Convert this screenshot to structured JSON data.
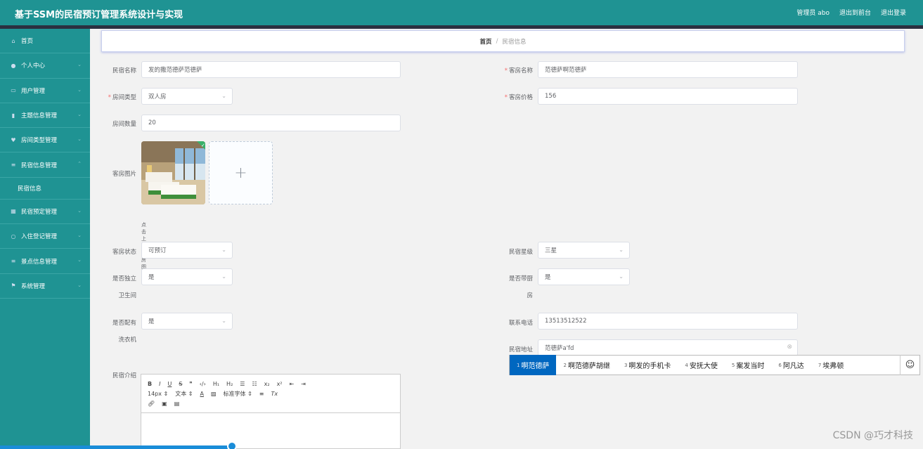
{
  "header": {
    "title": "基于SSM的民宿预订管理系统设计与实现",
    "admin_label": "管理员 abo",
    "exit_front": "退出到前台",
    "logout": "退出登录"
  },
  "sidebar": {
    "items": [
      {
        "label": "首页",
        "icon": "home-icon"
      },
      {
        "label": "个人中心",
        "icon": "user-icon"
      },
      {
        "label": "用户管理",
        "icon": "card-icon"
      },
      {
        "label": "主题信息管理",
        "icon": "chart-icon"
      },
      {
        "label": "房间类型管理",
        "icon": "heart-icon"
      },
      {
        "label": "民宿信息管理",
        "icon": "list-icon"
      },
      {
        "label": "民宿信息",
        "icon": ""
      },
      {
        "label": "民宿预定管理",
        "icon": "grid-icon"
      },
      {
        "label": "入住登记管理",
        "icon": "circle-icon"
      },
      {
        "label": "景点信息管理",
        "icon": "list-icon"
      },
      {
        "label": "系统管理",
        "icon": "flag-icon"
      }
    ]
  },
  "breadcrumb": {
    "home": "首页",
    "sep": "/",
    "current": "民宿信息"
  },
  "form": {
    "homestay_name": {
      "label": "民宿名称",
      "value": "发的撒范德萨范德萨"
    },
    "room_name": {
      "label": "客房名称",
      "value": "范德萨啊范德萨"
    },
    "room_type": {
      "label": "房间类型",
      "value": "双人房"
    },
    "room_price": {
      "label": "客房价格",
      "value": "156"
    },
    "room_count": {
      "label": "房间数量",
      "value": "20"
    },
    "room_image": {
      "label": "客房图片",
      "tip": "点击上传客房图片",
      "add": "+"
    },
    "room_status": {
      "label": "客房状态",
      "value": "可预订"
    },
    "star_level": {
      "label": "民宿星级",
      "value": "三星"
    },
    "private_bath": {
      "label_1": "是否独立",
      "label_2": "卫生间",
      "value": "是"
    },
    "kitchen": {
      "label_1": "是否带厨",
      "label_2": "房",
      "value": "是"
    },
    "washer": {
      "label_1": "是否配有",
      "label_2": "洗衣机",
      "value": "是"
    },
    "phone": {
      "label": "联系电话",
      "value": "13513512522"
    },
    "address": {
      "label": "民宿地址",
      "value": "范德萨a'fd"
    },
    "intro": {
      "label": "民宿介绍"
    }
  },
  "editor": {
    "size": "14px",
    "para": "文本",
    "font": "标准字体"
  },
  "ime": {
    "candidates": [
      {
        "n": "1",
        "text": "啊范德萨"
      },
      {
        "n": "2",
        "text": "啊范德萨胡继"
      },
      {
        "n": "3",
        "text": "啊发的手机卡"
      },
      {
        "n": "4",
        "text": "安抚大使"
      },
      {
        "n": "5",
        "text": "案发当时"
      },
      {
        "n": "6",
        "text": "阿凡达"
      },
      {
        "n": "7",
        "text": "埃弗顿"
      }
    ],
    "emoji": "☺"
  },
  "watermark": "CSDN @巧才科技",
  "colors": {
    "primary": "#1f9393",
    "accent": "#0067c0"
  }
}
